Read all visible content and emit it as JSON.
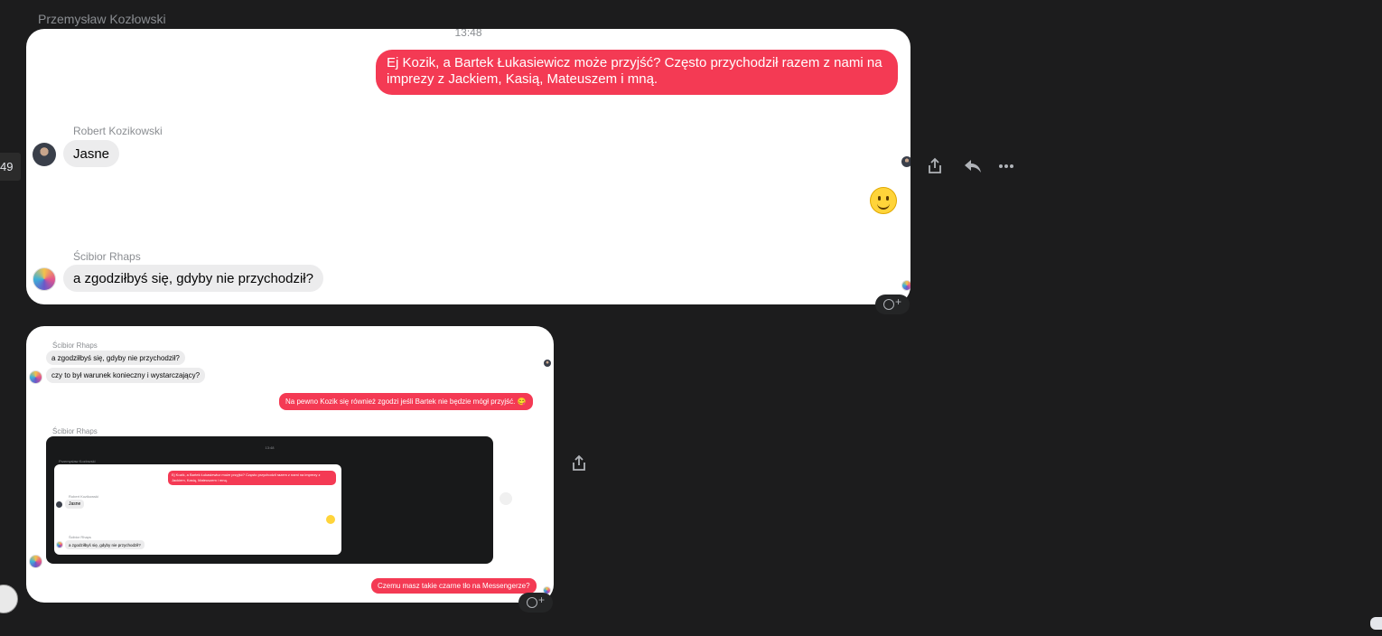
{
  "top_sender": "Przemysław Kozłowski",
  "left_badge": "49",
  "message_time": "13:48",
  "card1": {
    "outgoing_message": "Ej Kozik, a Bartek Łukasiewicz może przyjść? Często przychodził razem z nami na imprezy z Jackiem, Kasią, Mateuszem i mną.",
    "robert": {
      "name": "Robert Kozikowski",
      "message": "Jasne"
    },
    "scibior": {
      "name": "Ścibior Rhaps",
      "message": "a zgodziłbyś się, gdyby nie przychodził?"
    },
    "emoji_reaction": "slightly-smiling-face"
  },
  "toolbar": {
    "share_icon": "share-icon",
    "reply_icon": "reply-icon",
    "more_icon": "more-icon"
  },
  "card2": {
    "sender_a": "Ścibior Rhaps",
    "msg_a1": "a zgodziłbyś się, gdyby nie przychodził?",
    "msg_a2": "czy to był warunek konieczny i wystarczający?",
    "outgoing_1": "Na pewno Kozik się również zgodzi jeśli Bartek nie będzie mógł przyjść. 😋",
    "sender_b": "Ścibior Rhaps",
    "nested_time": "13:48",
    "nested_sender": "Przemysław Kozłowski",
    "nested_outgoing": "Ej Kozik, a Bartek Łukasiewicz może przyjść? Często przychodził razem z nami na imprezy z Jackiem, Kasią, Mateuszem i mną.",
    "nested_robert_name": "Robert Kozikowski",
    "nested_robert_msg": "Jasne",
    "nested_scibior_name": "Ścibior Rhaps",
    "nested_scibior_msg": "a zgodziłbyś się, gdyby nie przychodził?",
    "outgoing_2": "Czemu masz takie czarne tło na Messengerze?"
  },
  "colors": {
    "background": "#1c1c1d",
    "outgoing_bubble": "#f43a54",
    "incoming_bubble": "#ececed",
    "card": "#ffffff"
  }
}
